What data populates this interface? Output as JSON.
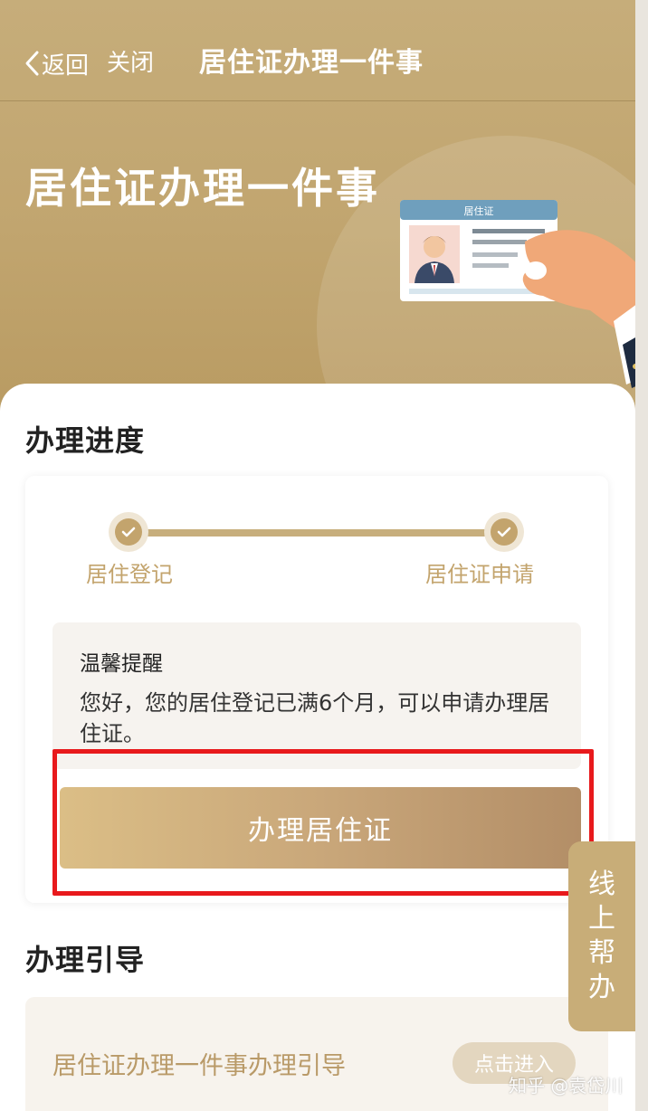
{
  "nav": {
    "back_label": "返回",
    "close_label": "关闭",
    "title": "居住证办理一件事"
  },
  "hero": {
    "title": "居住证办理一件事",
    "card_label": "居住证"
  },
  "progress": {
    "section_title": "办理进度",
    "steps": [
      {
        "label": "居住登记",
        "status": "done"
      },
      {
        "label": "居住证申请",
        "status": "done"
      }
    ]
  },
  "reminder": {
    "title": "温馨提醒",
    "body": "您好，您的居住登记已满6个月，可以申请办理居住证。"
  },
  "apply_button": {
    "label": "办理居住证"
  },
  "guide": {
    "section_title": "办理引导",
    "item_text": "居住证办理一件事办理引导",
    "enter_label": "点击进入"
  },
  "side_help": {
    "label": "线上帮办"
  },
  "watermark": "知乎 @袁岱川",
  "colors": {
    "brand_gold": "#c3a46d",
    "highlight_red": "#e8191c"
  }
}
